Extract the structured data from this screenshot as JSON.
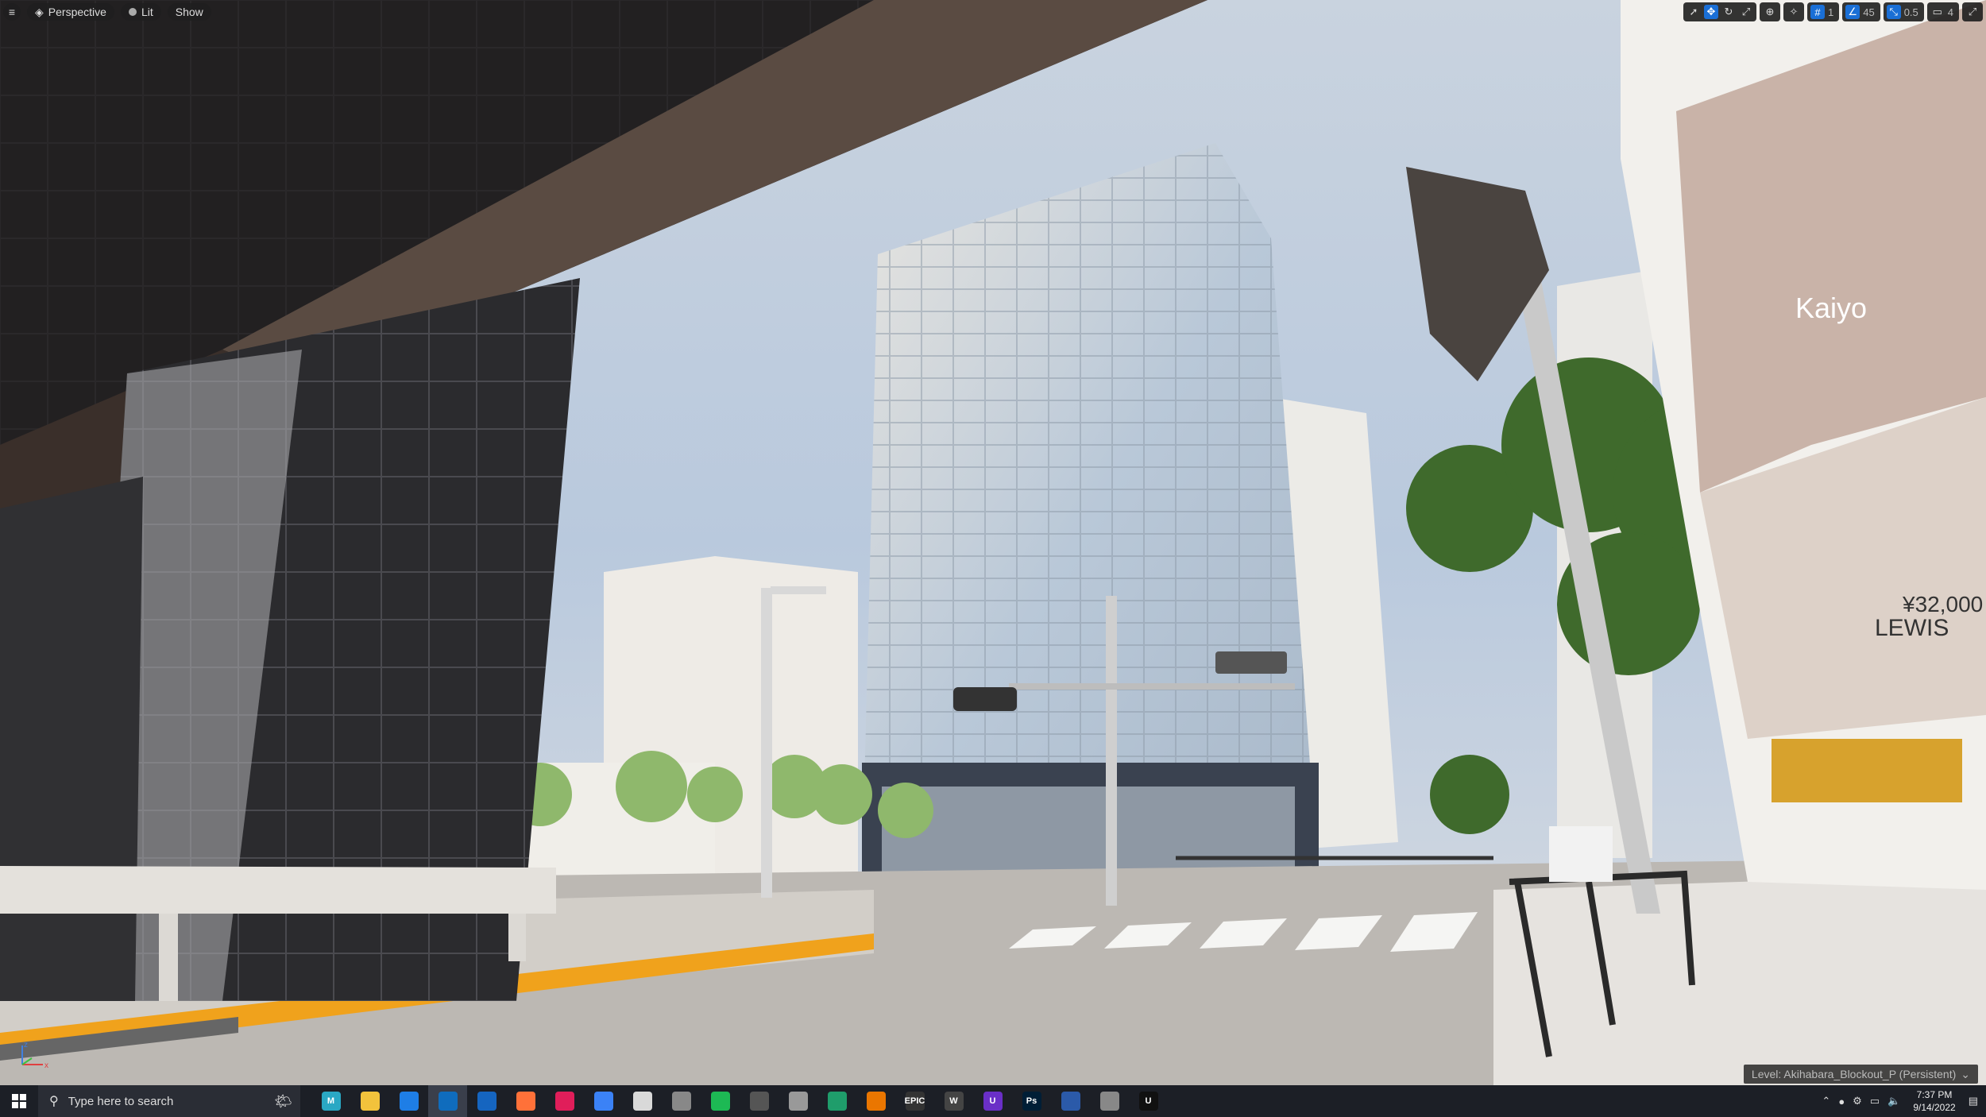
{
  "viewport": {
    "toolbar_left": {
      "perspective_label": "Perspective",
      "lit_label": "Lit",
      "show_label": "Show"
    },
    "toolbar_right": {
      "grid_snap_value": "1",
      "rotation_snap_value": "45",
      "scale_snap_value": "0.5",
      "camera_speed_value": "4"
    },
    "level_label": "Level: Akihabara_Blockout_P (Persistent)",
    "scene_signs": {
      "lewis": "LEWIS",
      "price": "¥32,000",
      "kaiyo": "Kaiyo"
    }
  },
  "taskbar": {
    "search_placeholder": "Type here to search",
    "apps": [
      {
        "name": "maya",
        "label": "M",
        "color": "#2aa8c4"
      },
      {
        "name": "file-explorer",
        "label": "",
        "color": "#f2c23c"
      },
      {
        "name": "security",
        "label": "",
        "color": "#1e7ee6"
      },
      {
        "name": "outlook",
        "label": "",
        "color": "#0f6cbd"
      },
      {
        "name": "shield-app",
        "label": "",
        "color": "#1565c0"
      },
      {
        "name": "firefox",
        "label": "",
        "color": "#ff7139"
      },
      {
        "name": "slack",
        "label": "",
        "color": "#e01e5a"
      },
      {
        "name": "drive",
        "label": "",
        "color": "#3b82f6"
      },
      {
        "name": "app-9",
        "label": "",
        "color": "#d9d9d9"
      },
      {
        "name": "davinci",
        "label": "",
        "color": "#888"
      },
      {
        "name": "spotify",
        "label": "",
        "color": "#1db954"
      },
      {
        "name": "obs",
        "label": "",
        "color": "#555"
      },
      {
        "name": "app-13",
        "label": "",
        "color": "#999"
      },
      {
        "name": "app-14",
        "label": "",
        "color": "#1f9d6b"
      },
      {
        "name": "blender",
        "label": "",
        "color": "#ea7600"
      },
      {
        "name": "epic",
        "label": "EPIC",
        "color": "#333"
      },
      {
        "name": "app-17",
        "label": "W",
        "color": "#444"
      },
      {
        "name": "app-18",
        "label": "U",
        "color": "#6a2fc7"
      },
      {
        "name": "photoshop",
        "label": "Ps",
        "color": "#001e36"
      },
      {
        "name": "app-20",
        "label": "",
        "color": "#2b5aa9"
      },
      {
        "name": "app-21",
        "label": "",
        "color": "#888"
      },
      {
        "name": "unreal",
        "label": "U",
        "color": "#111"
      }
    ],
    "clock_time": "7:37 PM",
    "clock_date": "9/14/2022"
  }
}
